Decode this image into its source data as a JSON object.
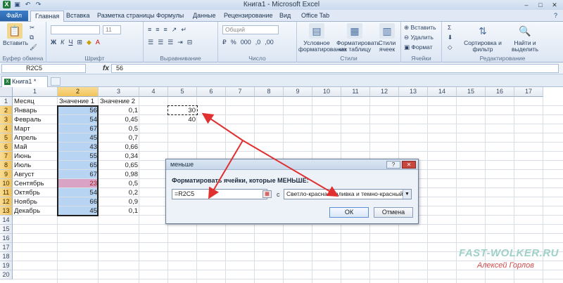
{
  "window": {
    "title": "Книга1 - Microsoft Excel"
  },
  "ribbon_tabs": [
    "Файл",
    "Главная",
    "Вставка",
    "Разметка страницы",
    "Формулы",
    "Данные",
    "Рецензирование",
    "Вид",
    "Office Tab"
  ],
  "ribbon": {
    "paste_label": "Вставить",
    "clipboard_label": "Буфер обмена",
    "font_label": "Шрифт",
    "font_size": "11",
    "align_label": "Выравнивание",
    "number_label": "Число",
    "number_format": "Общий",
    "cond_format": "Условное форматирование",
    "format_table": "Форматировать как таблицу",
    "cell_styles": "Стили ячеек",
    "styles_label": "Стили",
    "insert": "Вставить",
    "delete": "Удалить",
    "format": "Формат",
    "cells_label": "Ячейки",
    "sort": "Сортировка и фильтр",
    "find": "Найти и выделить",
    "editing_label": "Редактирование"
  },
  "formula_bar": {
    "name_box": "R2C5",
    "fx": "fx",
    "value": "56"
  },
  "workbook_tab": {
    "label": "Книга1 *"
  },
  "columns": [
    "1",
    "2",
    "3",
    "4",
    "5",
    "6",
    "7",
    "8",
    "9",
    "10",
    "11",
    "12",
    "13",
    "14",
    "15",
    "16",
    "17"
  ],
  "rows": [
    "1",
    "2",
    "3",
    "4",
    "5",
    "6",
    "7",
    "8",
    "9",
    "10",
    "11",
    "12",
    "13",
    "14",
    "15",
    "16",
    "17",
    "18",
    "19",
    "20"
  ],
  "table": {
    "headers": [
      "Месяц",
      "Значение 1",
      "Значение 2"
    ],
    "rows": [
      [
        "Январь",
        "56",
        "0,1"
      ],
      [
        "Февраль",
        "54",
        "0,45"
      ],
      [
        "Март",
        "67",
        "0,5"
      ],
      [
        "Апрель",
        "45",
        "0,7"
      ],
      [
        "Май",
        "43",
        "0,66"
      ],
      [
        "Июнь",
        "55",
        "0,34"
      ],
      [
        "Июль",
        "65",
        "0,65"
      ],
      [
        "Август",
        "67",
        "0,98"
      ],
      [
        "Сентябрь",
        "23",
        "0,5"
      ],
      [
        "Октябрь",
        "54",
        "0,2"
      ],
      [
        "Ноябрь",
        "66",
        "0,9"
      ],
      [
        "Декабрь",
        "45",
        "0,1"
      ]
    ]
  },
  "col5_values": [
    "30",
    "40"
  ],
  "dialog": {
    "title": "меньше",
    "prompt": "Форматировать ячейки, которые МЕНЬШЕ:",
    "input_value": "=R2C5",
    "with_label": "с",
    "format_option": "Светло-красная заливка и темно-красный текст",
    "ok": "ОК",
    "cancel": "Отмена"
  },
  "watermark": {
    "site": "FAST-WOLKER.RU",
    "author": "Алексей Горлов"
  }
}
